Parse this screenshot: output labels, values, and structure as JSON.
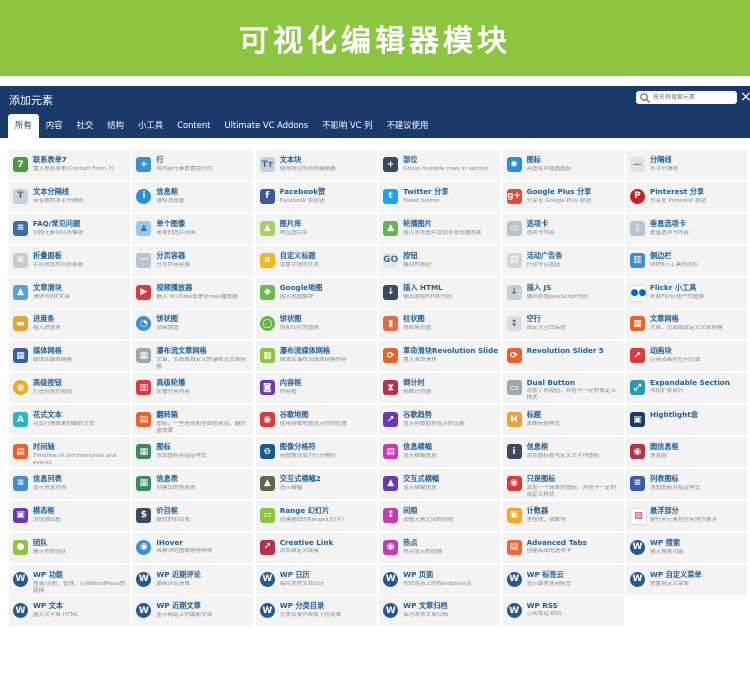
{
  "banner": {
    "title": "可视化编辑器模块"
  },
  "panel": {
    "title": "添加元素",
    "search_placeholder": "按名称搜索元素",
    "close_glyph": "×"
  },
  "tabs": [
    {
      "label": "所有",
      "active": true
    },
    {
      "label": "内容"
    },
    {
      "label": "社交"
    },
    {
      "label": "结构"
    },
    {
      "label": "小工具"
    },
    {
      "label": "Content"
    },
    {
      "label": "Ultimate VC Addons"
    },
    {
      "label": "不影响 VC 列"
    },
    {
      "label": "不建议使用"
    }
  ],
  "elements": [
    {
      "title": "联系表单7",
      "desc": "置入联系表单(Contact Form 7)",
      "icon": "contact-form-icon",
      "glyph": "7",
      "color": "#4b9a3d"
    },
    {
      "title": "行",
      "desc": "将内容元素放置在行内",
      "icon": "row-plus-icon",
      "glyph": "+",
      "color": "#3d8fd1"
    },
    {
      "title": "文本块",
      "desc": "使用所见即所得编辑器",
      "icon": "text-block-icon",
      "glyph": "Tт",
      "color": "#c8d0d8",
      "fg": "#4a6c8c"
    },
    {
      "title": "部位",
      "desc": "Group multiple rows in section",
      "icon": "section-plus-icon",
      "glyph": "+",
      "color": "#3a4a5e"
    },
    {
      "title": "图标",
      "desc": "从图库中插图图标",
      "icon": "icon-star-icon",
      "glyph": "✹",
      "color": "#2a8fd6"
    },
    {
      "title": "分隔线",
      "desc": "水平分隔线",
      "icon": "separator-icon",
      "glyph": "—",
      "color": "#e2e2e2",
      "fg": "#888888"
    },
    {
      "title": "文本分隔线",
      "desc": "带有数的水平分隔线",
      "icon": "text-separator-icon",
      "glyph": "T",
      "color": "#c8d0d8",
      "fg": "#4a6c8c"
    },
    {
      "title": "信息框",
      "desc": "通知消息框",
      "icon": "info-icon",
      "glyph": "i",
      "color": "#2a8fd6",
      "round": true
    },
    {
      "title": "Facebook赞",
      "desc": "Facebook 赞按钮",
      "icon": "facebook-icon",
      "glyph": "f",
      "color": "#3b5998"
    },
    {
      "title": "Twitter 分享",
      "desc": "Tweet button",
      "icon": "twitter-icon",
      "glyph": "t",
      "color": "#1da1f2"
    },
    {
      "title": "Google Plus 分享",
      "desc": "分享至 Google Plus 按钮",
      "icon": "google-plus-icon",
      "glyph": "g+",
      "color": "#dd4b39"
    },
    {
      "title": "Pinterest 分享",
      "desc": "分享至 Pinterest 按钮",
      "icon": "pinterest-icon",
      "glyph": "P",
      "color": "#cb2027",
      "round": true
    },
    {
      "title": "FAQ/常见问题",
      "desc": "切换元素到问答模块",
      "icon": "faq-icon",
      "glyph": "≡",
      "color": "#3a6ea5"
    },
    {
      "title": "单个图像",
      "desc": "简单的图片动画",
      "icon": "single-image-icon",
      "glyph": "▲",
      "color": "#9ec8ea",
      "fg": "#3a7bb4"
    },
    {
      "title": "图片库",
      "desc": "响应图片库",
      "icon": "gallery-icon",
      "glyph": "▲",
      "color": "#a7d068",
      "fg": "#ffffff"
    },
    {
      "title": "轮播图片",
      "desc": "插入多张图片增加多张轮播效果",
      "icon": "carousel-icon",
      "glyph": "▲",
      "color": "#67b34e"
    },
    {
      "title": "选项卡",
      "desc": "选项卡内容",
      "icon": "tabs-icon",
      "glyph": "▭",
      "color": "#b8c4cf",
      "fg": "#ffffff"
    },
    {
      "title": "垂直选项卡",
      "desc": "垂直选项卡内容",
      "icon": "vertical-tabs-icon",
      "glyph": "▯",
      "color": "#b8c4cf",
      "fg": "#ffffff"
    },
    {
      "title": "折叠面板",
      "desc": "手风琴式的可折面板",
      "icon": "accordion-icon",
      "glyph": "≡",
      "color": "#c5ccd4",
      "fg": "#ffffff"
    },
    {
      "title": "分页容器",
      "desc": "分页内容容器",
      "icon": "pageable-icon",
      "glyph": "⋯",
      "color": "#b8c4cf",
      "fg": "#ffffff"
    },
    {
      "title": "自定义标题",
      "desc": "设置字体的文本",
      "icon": "custom-heading-icon",
      "glyph": "a",
      "color": "#f5b623"
    },
    {
      "title": "按钮",
      "desc": "醒目的按钮",
      "icon": "button-icon",
      "glyph": "GO",
      "color": "#e4e8ec",
      "fg": "#4a6c8c"
    },
    {
      "title": "活动广告条",
      "desc": "行动号召按钮",
      "icon": "cta-icon",
      "glyph": "▤",
      "color": "#d0d6dc",
      "fg": "#ffffff"
    },
    {
      "title": "侧边栏",
      "desc": "WP侧小工具的边栏",
      "icon": "sidebar-icon",
      "glyph": "▥",
      "color": "#3d8fd1"
    },
    {
      "title": "文章滑块",
      "desc": "滑块与WP文章",
      "icon": "post-slider-icon",
      "glyph": "▲",
      "color": "#5aa0d8"
    },
    {
      "title": "视频播放器",
      "desc": "嵌入 YouTube或是Vimeo播放器",
      "icon": "video-player-icon",
      "glyph": "▶",
      "color": "#d93a3a"
    },
    {
      "title": "Google地图",
      "desc": "插入地图模块",
      "icon": "google-maps-icon",
      "glyph": "◆",
      "color": "#6fb94f"
    },
    {
      "title": "插入 HTML",
      "desc": "输出原始HTML代码",
      "icon": "raw-html-icon",
      "glyph": "↓",
      "color": "#3a4a5e"
    },
    {
      "title": "插入 JS",
      "desc": "输出原始JavaScript代码",
      "icon": "raw-js-icon",
      "glyph": "↓",
      "color": "#c8d0d8",
      "fg": "#4a6c8c"
    },
    {
      "title": "Flickr 小工具",
      "desc": "来自Flickr账户的图像",
      "icon": "flickr-icon",
      "glyph": "●●",
      "color": "#ffffff",
      "fg": "#0063dc"
    },
    {
      "title": "进度条",
      "desc": "插入进度条",
      "icon": "progress-bar-icon",
      "glyph": "▬",
      "color": "#e8a23a"
    },
    {
      "title": "饼状图",
      "desc": "动画饼图",
      "icon": "pie-chart-icon",
      "glyph": "◔",
      "color": "#3d8fd1",
      "round": true
    },
    {
      "title": "饼状图",
      "desc": "饼和切片的图表",
      "icon": "round-chart-icon",
      "glyph": "◯",
      "color": "#67b34e",
      "round": true
    },
    {
      "title": "柱状图",
      "desc": "线和条形图",
      "icon": "bar-chart-icon",
      "glyph": "▮",
      "color": "#e86a3a"
    },
    {
      "title": "空行",
      "desc": "自定义空白高度",
      "icon": "empty-space-icon",
      "glyph": "↕",
      "color": "#d8dee4",
      "fg": "#4a6c8c"
    },
    {
      "title": "文章网格",
      "desc": "文章、页面或自定义文章网格",
      "icon": "post-grid-icon",
      "glyph": "▦",
      "color": "#e8622a"
    },
    {
      "title": "媒体网格",
      "desc": "媒体库媒体网格",
      "icon": "media-grid-icon",
      "glyph": "▦",
      "color": "#3a5ea5"
    },
    {
      "title": "瀑布流文章网格",
      "desc": "文章、页面或自定义的瀑布流文章网格",
      "icon": "masonry-grid-icon",
      "glyph": "▦",
      "color": "#9ca8b4"
    },
    {
      "title": "瀑布流媒体网格",
      "desc": "媒体库瀑布流媒体网格内容",
      "icon": "masonry-media-icon",
      "glyph": "▦",
      "color": "#8cc640"
    },
    {
      "title": "革命滑块Revolution Slider",
      "desc": "置入革命滑块",
      "icon": "revolution-icon",
      "glyph": "⟳",
      "color": "#e8622a"
    },
    {
      "title": "Revolution Slider 5",
      "desc": "",
      "icon": "revolution5-icon",
      "glyph": "⟳",
      "color": "#e8622a"
    },
    {
      "title": "动画块",
      "desc": "应用动画在任何页面",
      "icon": "animated-block-icon",
      "glyph": "↗",
      "color": "#d93a3a"
    },
    {
      "title": "高级按钮",
      "desc": "打造创意的按钮",
      "icon": "advanced-button-icon",
      "glyph": "◉",
      "color": "#f5a623",
      "round": true
    },
    {
      "title": "高级轮播",
      "desc": "轮播任何内容",
      "icon": "advanced-carousel-icon",
      "glyph": "▥",
      "color": "#d93a3a"
    },
    {
      "title": "内容框",
      "desc": "内容框",
      "icon": "content-box-icon",
      "glyph": "◙",
      "color": "#6a3ab4"
    },
    {
      "title": "倒计时",
      "desc": "倒数计时器",
      "icon": "countdown-icon",
      "glyph": "⧗",
      "color": "#b4324a"
    },
    {
      "title": "Dual Button",
      "desc": "添加了两按钮，并给予一定的自定义样式",
      "icon": "dual-button-icon",
      "glyph": "▭",
      "color": "#9ca8b4"
    },
    {
      "title": "Expandable Section",
      "desc": "添加扩张部分",
      "icon": "expandable-icon",
      "glyph": "⤢",
      "color": "#2a9ab4"
    },
    {
      "title": "花式文本",
      "desc": "花式行情效果的翻转文本",
      "icon": "fancy-text-icon",
      "glyph": "A",
      "color": "#2ab4c8"
    },
    {
      "title": "翻转箱",
      "desc": "图标、一些信息和全面在网站，翻转盒效果",
      "icon": "flip-box-icon",
      "glyph": "▤",
      "color": "#e8622a"
    },
    {
      "title": "谷歌地图",
      "desc": "使用谷歌地图显示你的位置",
      "icon": "ult-maps-icon",
      "glyph": "◉",
      "color": "#d93a3a"
    },
    {
      "title": "谷歌趋势",
      "desc": "显示谷歌趋势显示的见解",
      "icon": "google-trends-icon",
      "glyph": "↗",
      "color": "#6a3ab4"
    },
    {
      "title": "标题",
      "desc": "真棒标题样式",
      "icon": "headings-icon",
      "glyph": "H",
      "color": "#e8a23a"
    },
    {
      "title": "Hightlight盒",
      "desc": "",
      "icon": "highlight-box-icon",
      "glyph": "▣",
      "color": "#1a3a6c"
    },
    {
      "title": "时间轴",
      "desc": "Timeline of old memories and events",
      "icon": "timeline-icon",
      "glyph": "▤",
      "color": "#e8622a"
    },
    {
      "title": "图标",
      "desc": "添加图标并指定样式",
      "icon": "ult-icons-icon",
      "glyph": "▦",
      "color": "#3a8a5e"
    },
    {
      "title": "图像分格符",
      "desc": "用图像添加为行分隔符",
      "icon": "image-separator-icon",
      "glyph": "⊖",
      "color": "#1a5a8c"
    },
    {
      "title": "信息横幅",
      "desc": "显示横幅信息",
      "icon": "info-banner-icon",
      "glyph": "▤",
      "color": "#c83ab4"
    },
    {
      "title": "信息框",
      "desc": "添加图标框与定义文字作图标",
      "icon": "ult-info-box-icon",
      "glyph": "i",
      "color": "#3a4a5e"
    },
    {
      "title": "圆信息框",
      "desc": "信息圈",
      "icon": "info-circle-icon",
      "glyph": "◉",
      "color": "#b4324a"
    },
    {
      "title": "信息列表",
      "desc": "显示信息列表",
      "icon": "info-list-icon",
      "glyph": "≡",
      "color": "#3d8fd1"
    },
    {
      "title": "信息表",
      "desc": "创建您的信息表",
      "icon": "info-tables-icon",
      "glyph": "▦",
      "color": "#3a8a5e"
    },
    {
      "title": "交互式横幅2",
      "desc": "显示横幅",
      "icon": "interactive-banner2-icon",
      "glyph": "▲",
      "color": "#5a6a4a"
    },
    {
      "title": "交互式横幅",
      "desc": "显示横幅信息",
      "icon": "interactive-banner-icon",
      "glyph": "▲",
      "color": "#6a3ab4"
    },
    {
      "title": "只是图标",
      "desc": "添加一个简单的图标，并给予一定的自定义样式",
      "icon": "just-icon-icon",
      "glyph": "◉",
      "color": "#d93a3a"
    },
    {
      "title": "列表图标",
      "desc": "添加图标并指定样式",
      "icon": "list-icon-icon",
      "glyph": "≡",
      "color": "#3a5ea5"
    },
    {
      "title": "模态框",
      "desc": "添加弹出框",
      "icon": "modal-box-icon",
      "glyph": "▣",
      "color": "#6a3ab4"
    },
    {
      "title": "价目框",
      "desc": "酷炫的价目表",
      "icon": "price-box-icon",
      "glyph": "$",
      "color": "#3a4a5e"
    },
    {
      "title": "Range 幻灯片",
      "desc": "创建酷炫的Range幻灯片！",
      "icon": "range-slider-icon",
      "glyph": "▭",
      "color": "#8cc640"
    },
    {
      "title": "间隙",
      "desc": "调整元素之间的间隙",
      "icon": "spacer-icon",
      "glyph": "↕",
      "color": "#c83ab4"
    },
    {
      "title": "计数器",
      "desc": "里程碑，或数等",
      "icon": "counter-icon",
      "glyph": "▣",
      "color": "#f5a623"
    },
    {
      "title": "悬浮部分",
      "desc": "使任何元素在任何地方悬浮",
      "icon": "sticky-icon",
      "glyph": "▨",
      "color": "#ffffff",
      "fg": "#b4324a"
    },
    {
      "title": "团队",
      "desc": "展示你的团队",
      "icon": "team-icon",
      "glyph": "●",
      "color": "#8cc640"
    },
    {
      "title": "iHover",
      "desc": "带悬浮的图像悬停特效",
      "icon": "ihover-icon",
      "glyph": "◉",
      "color": "#3d8fd1",
      "round": true
    },
    {
      "title": "Creative Link",
      "desc": "添加自定义链接",
      "icon": "creative-link-icon",
      "glyph": "↗",
      "color": "#b4324a"
    },
    {
      "title": "热点",
      "desc": "热点显示的图像",
      "icon": "hotspot-icon",
      "glyph": "◉",
      "color": "#c83ab4"
    },
    {
      "title": "Advanced Tabs",
      "desc": "创建高级的选项卡",
      "icon": "advanced-tabs-icon",
      "glyph": "▤",
      "color": "#e86a3a"
    },
    {
      "title": "WP 搜索",
      "desc": "插入搜索功能",
      "icon": "wp-search-icon",
      "glyph": "W",
      "color": "#2a5a8c",
      "round": true
    },
    {
      "title": "WP 功能",
      "desc": "登录/注册、管理，订阅WordPress的链接",
      "icon": "wp-meta-icon",
      "glyph": "W",
      "color": "#2a5a8c",
      "round": true
    },
    {
      "title": "WP 近期评论",
      "desc": "最新评论清单",
      "icon": "wp-recent-comments-icon",
      "glyph": "W",
      "color": "#2a5a8c",
      "round": true
    },
    {
      "title": "WP 日历",
      "desc": "每月发布文章日历",
      "icon": "wp-calendar-icon",
      "glyph": "W",
      "color": "#2a5a8c",
      "round": true
    },
    {
      "title": "WP 页面",
      "desc": "你的站点上的Wordpress页",
      "icon": "wp-pages-icon",
      "glyph": "W",
      "color": "#2a5a8c",
      "round": true
    },
    {
      "title": "WP 标签云",
      "desc": "显示最常使用标签",
      "icon": "wp-tagcloud-icon",
      "glyph": "W",
      "color": "#2a5a8c",
      "round": true
    },
    {
      "title": "WP 自定义菜单",
      "desc": "放置自定义菜单",
      "icon": "wp-custom-menu-icon",
      "glyph": "W",
      "color": "#2a5a8c",
      "round": true
    },
    {
      "title": "WP 文本",
      "desc": "插入文字或 HTML",
      "icon": "wp-text-icon",
      "glyph": "W",
      "color": "#2a5a8c",
      "round": true
    },
    {
      "title": "WP 近期文章",
      "desc": "显示网站上的最新文章",
      "icon": "wp-recent-posts-icon",
      "glyph": "W",
      "color": "#2a5a8c",
      "round": true
    },
    {
      "title": "WP 分类目录",
      "desc": "分类目录列表或下拉菜单",
      "icon": "wp-categories-icon",
      "glyph": "W",
      "color": "#2a5a8c",
      "round": true
    },
    {
      "title": "WP 文章归档",
      "desc": "每月发布文章归档",
      "icon": "wp-archives-icon",
      "glyph": "W",
      "color": "#2a5a8c",
      "round": true
    },
    {
      "title": "WP RSS",
      "desc": "订阅本站 RSS",
      "icon": "wp-rss-icon",
      "glyph": "W",
      "color": "#2a5a8c",
      "round": true
    }
  ]
}
